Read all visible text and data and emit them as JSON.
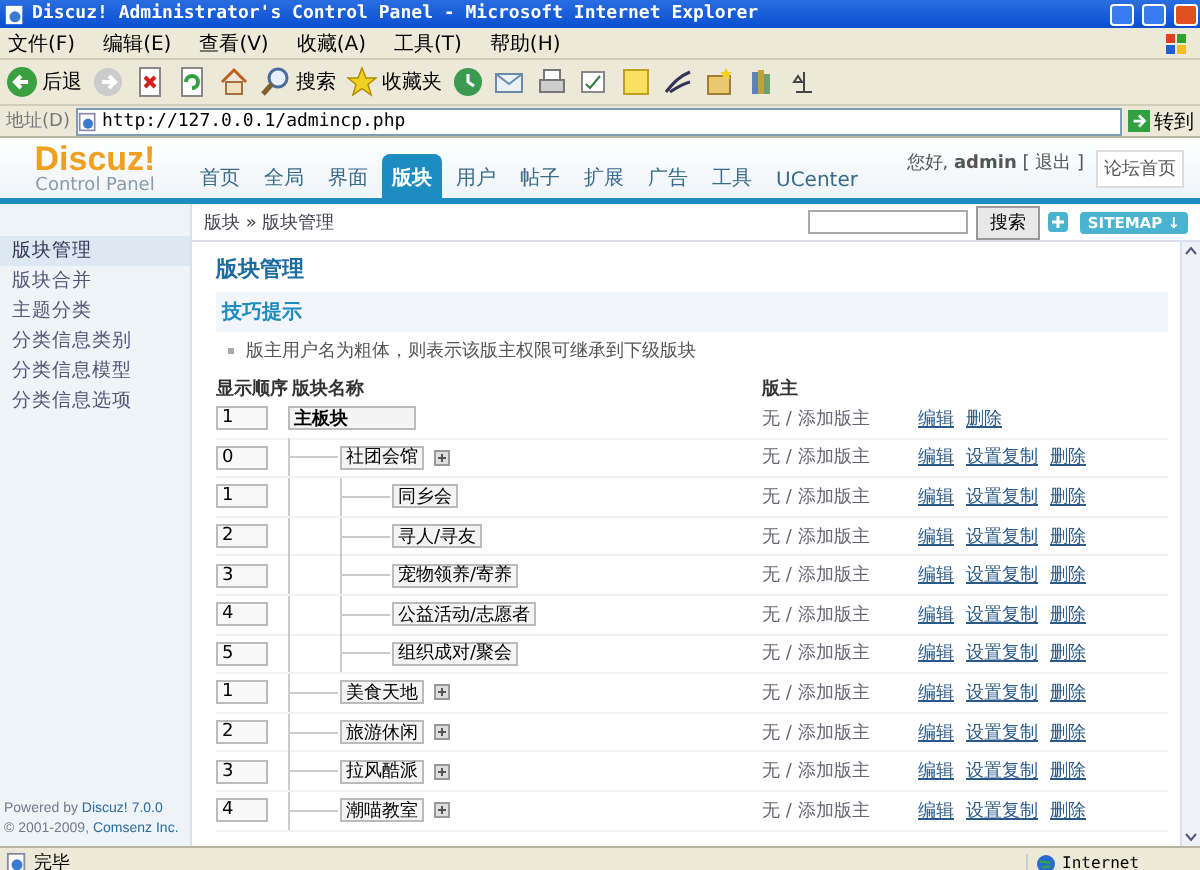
{
  "window": {
    "title": "Discuz! Administrator's Control Panel - Microsoft Internet Explorer"
  },
  "menu": [
    "文件(F)",
    "编辑(E)",
    "查看(V)",
    "收藏(A)",
    "工具(T)",
    "帮助(H)"
  ],
  "toolbar": [
    {
      "kind": "back",
      "label": "后退"
    },
    {
      "kind": "search",
      "label": "搜索"
    },
    {
      "kind": "favorites",
      "label": "收藏夹"
    }
  ],
  "address": {
    "label": "地址(D)",
    "url": "http://127.0.0.1/admincp.php",
    "go": "转到"
  },
  "logo": {
    "title": "Discuz!",
    "subtitle": "Control Panel"
  },
  "nav": [
    {
      "label": "首页",
      "selected": false
    },
    {
      "label": "全局",
      "selected": false
    },
    {
      "label": "界面",
      "selected": false
    },
    {
      "label": "版块",
      "selected": true
    },
    {
      "label": "用户",
      "selected": false
    },
    {
      "label": "帖子",
      "selected": false
    },
    {
      "label": "扩展",
      "selected": false
    },
    {
      "label": "广告",
      "selected": false
    },
    {
      "label": "工具",
      "selected": false
    },
    {
      "label": "UCenter",
      "selected": false
    }
  ],
  "user": {
    "greeting": "您好, ",
    "name": "admin",
    "logout": "[ 退出 ]",
    "home": "论坛首页"
  },
  "breadcrumb": "版块 » 版块管理",
  "search_button": "搜索",
  "sitemap": "SITEMAP ↓",
  "sidebar": {
    "items": [
      {
        "label": "版块管理",
        "selected": true
      },
      {
        "label": "版块合并",
        "selected": false
      },
      {
        "label": "主题分类",
        "selected": false
      },
      {
        "label": "分类信息类别",
        "selected": false
      },
      {
        "label": "分类信息模型",
        "selected": false
      },
      {
        "label": "分类信息选项",
        "selected": false
      }
    ],
    "footer": [
      {
        "text": "Powered by ",
        "link": "Discuz! 7.0.0"
      },
      {
        "text": "© 2001-2009, ",
        "link": "Comsenz Inc."
      }
    ]
  },
  "page_title": "版块管理",
  "tips": {
    "title": "技巧提示",
    "items": [
      "版主用户名为粗体，则表示该版主权限可继承到下级版块"
    ]
  },
  "columns": [
    "显示顺序",
    "版块名称",
    "版主"
  ],
  "forums": [
    {
      "order": "1",
      "name": "主板块",
      "moderators": "无 / 添加版主",
      "actions": [
        "编辑",
        "删除"
      ],
      "children": [
        {
          "order": "0",
          "name": "社团会馆",
          "moderators": "无 / 添加版主",
          "actions": [
            "编辑",
            "设置复制",
            "删除"
          ],
          "children": [
            {
              "order": "1",
              "name": "同乡会",
              "moderators": "无 / 添加版主",
              "actions": [
                "编辑",
                "设置复制",
                "删除"
              ]
            },
            {
              "order": "2",
              "name": "寻人/寻友",
              "moderators": "无 / 添加版主",
              "actions": [
                "编辑",
                "设置复制",
                "删除"
              ]
            },
            {
              "order": "3",
              "name": "宠物领养/寄养",
              "moderators": "无 / 添加版主",
              "actions": [
                "编辑",
                "设置复制",
                "删除"
              ]
            },
            {
              "order": "4",
              "name": "公益活动/志愿者",
              "moderators": "无 / 添加版主",
              "actions": [
                "编辑",
                "设置复制",
                "删除"
              ]
            },
            {
              "order": "5",
              "name": "组织成对/聚会",
              "moderators": "无 / 添加版主",
              "actions": [
                "编辑",
                "设置复制",
                "删除"
              ]
            }
          ]
        },
        {
          "order": "1",
          "name": "美食天地",
          "moderators": "无 / 添加版主",
          "actions": [
            "编辑",
            "设置复制",
            "删除"
          ]
        },
        {
          "order": "2",
          "name": "旅游休闲",
          "moderators": "无 / 添加版主",
          "actions": [
            "编辑",
            "设置复制",
            "删除"
          ]
        },
        {
          "order": "3",
          "name": "拉风酷派",
          "moderators": "无 / 添加版主",
          "actions": [
            "编辑",
            "设置复制",
            "删除"
          ]
        },
        {
          "order": "4",
          "name": "潮喵教室",
          "moderators": "无 / 添加版主",
          "actions": [
            "编辑",
            "设置复制",
            "删除"
          ]
        }
      ]
    }
  ],
  "status": {
    "text": "完毕",
    "zone": "Internet"
  }
}
